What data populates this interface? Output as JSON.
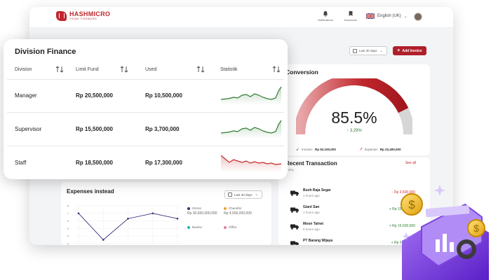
{
  "topbar": {
    "brand": "HASHMICRO",
    "tagline": "THINK FORWARD",
    "notifications_label": "Notifications",
    "bookmark_label": "Bookmark",
    "language": "English (UK)"
  },
  "toolbar": {
    "date_filter": "Last 30 days",
    "add_invoice": "Add Invoice"
  },
  "conversion": {
    "title": "Conversion",
    "value": "85.5%",
    "delta": "3.29%",
    "gauge_fraction": 0.855,
    "income_label": "Income:",
    "income_value": "Rp 52,100,000",
    "expense_label": "Expense:",
    "expense_value": "Rp 22,400,000"
  },
  "recent_transaction": {
    "title": "Recent Transaction",
    "subtitle": "Today",
    "see_all": "See all",
    "rows": [
      {
        "name": "Bush Raja Segar",
        "time": "1 hours ago",
        "amount": "- Rp 3,500,000",
        "sign": "neg"
      },
      {
        "name": "Giant San",
        "time": "1 hours ago",
        "amount": "+ Rp 15,000,000",
        "sign": "pos"
      },
      {
        "name": "Moon Talnet",
        "time": "5 hours ago",
        "amount": "+ Rp 16,500,000",
        "sign": "pos"
      },
      {
        "name": "PT Barang Wijaya",
        "time": "6 hours ago",
        "amount": "+ Rp 2,500,000",
        "sign": "pos"
      }
    ]
  },
  "expenses": {
    "title": "Expenses instead",
    "date_filter": "Last 30 days",
    "legend": [
      {
        "name": "Gizmo",
        "value": "Rp 30,650,000,000",
        "color": "#3a2f7a"
      },
      {
        "name": "Chaonfer",
        "value": "Rp 4,500,000,000",
        "color": "#f0a030"
      },
      {
        "name": "Bueino",
        "value": "",
        "color": "#22b8a5"
      },
      {
        "name": "Office",
        "value": "",
        "color": "#e07aa8"
      }
    ]
  },
  "chart_data": {
    "type": "line",
    "title": "Expenses instead",
    "y_ticks": [
      "8",
      "7",
      "6",
      "5",
      "4",
      "3"
    ],
    "x": [
      0,
      1,
      2,
      3,
      4
    ],
    "series": [
      {
        "values": [
          7,
          3.5,
          6.3,
          7,
          6.3
        ]
      }
    ],
    "ylim": [
      3,
      8
    ]
  },
  "division": {
    "title": "Division Finance",
    "headers": {
      "division": "Division",
      "limit": "Limit Fund",
      "used": "Used",
      "stat": "Statistik"
    },
    "rows": [
      {
        "division": "Manager",
        "limit": "Rp 20,500,000",
        "used": "Rp 10,500,000",
        "trend": "up",
        "color": "#2e7d32"
      },
      {
        "division": "Supervisor",
        "limit": "Rp 15,500,000",
        "used": "Rp 3,700,000",
        "trend": "up",
        "color": "#2e7d32"
      },
      {
        "division": "Staff",
        "limit": "Rp 18,500,000",
        "used": "Rp 17,300,000",
        "trend": "down",
        "color": "#c62828"
      }
    ]
  },
  "colors": {
    "brand": "#c0272d",
    "positive": "#2e7d32",
    "negative": "#d32f2f",
    "decor_purple": "#7b3fe0"
  }
}
